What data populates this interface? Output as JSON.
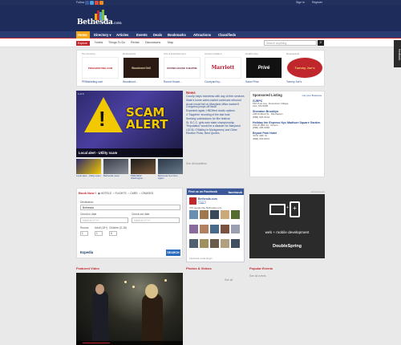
{
  "topbar": {
    "follow": "Follow",
    "sign_in": "Sign In",
    "register": "Register"
  },
  "logo": {
    "name": "Bethesda",
    "tld": ".com"
  },
  "nav": {
    "home": "Home",
    "items": [
      "Directory ▾",
      "Articles",
      "Events",
      "Deals",
      "Bookmarks",
      "Attractions",
      "Classifieds"
    ]
  },
  "subnav": {
    "explore": "Explore",
    "items": [
      "Hotels",
      "Things To Do",
      "Rental",
      "Discussions",
      "Map"
    ]
  },
  "search": {
    "placeholder": "Search anything"
  },
  "feedback": "feedback",
  "sponsors": [
    {
      "cat": "Pet Services",
      "logo": "PRMARKETING.COM",
      "name": "PRMarketing.com"
    },
    {
      "cat": "Restaurants",
      "logo": "Woodmont Grill",
      "name": "Woodmont..."
    },
    {
      "cat": "Arts & Entertainment",
      "logo": "ROUND HOUSE THEATRE",
      "name": "Round House..."
    },
    {
      "cat": "Accommodation",
      "logo": "Marriott",
      "name": "Courtyard by..."
    },
    {
      "cat": "Health Care",
      "logo": "Privé",
      "name": "Salon Prive"
    },
    {
      "cat": "Restaurants",
      "logo": "Tommy Joe's",
      "name": "Tommy Joe's"
    }
  ],
  "hero": {
    "tag": "1 of 6",
    "headline_line1": "SCAM",
    "headline_line2": "ALERT",
    "caption": "Local alert - Utility scam"
  },
  "thumbs": [
    {
      "label": "Local alert - Utility scam"
    },
    {
      "label": "Bethesda news"
    },
    {
      "label": "PREVIEW: Washington..."
    },
    {
      "label": "Bethesda Not Ours Again"
    }
  ],
  "news": {
    "title": "News",
    "items": [
      "County helps homeless with day of free services",
      "State's home sales market continues rebound",
      "Avoid crowd fail on Maryland office market if Congress jumps off fiscal",
      "Expected again, HBO/text studio options",
      "4 'Sapphire' shooting of the last host",
      "Seeking submissions for film festival",
      "St. B.C.C. girls earn state championship",
      "'Reputation' would be a disaster for Maryland",
      "LSCM, O'Malley in Montgomery and Other Election Picks, Best Quotes"
    ],
    "see_all": "See all headlines"
  },
  "listing": {
    "title": "Sponsored Listing",
    "list_your_business": "List your Business",
    "entries": [
      {
        "name": "GJRPC",
        "lines": [
          "915 Post Ave, Downtown Village",
          "212-726-5655"
        ]
      },
      {
        "name": "Sheraton Brooklyn",
        "lines": [
          "228 Duffield St., Manhattan",
          "(888) 625-5144"
        ]
      },
      {
        "name": "Holiday Inn Express Nyc Madison Square Garden",
        "lines": [
          "232 W 29th St., Clinton",
          "(888) 305-9082"
        ]
      },
      {
        "name": "Bryant Park Hotel",
        "lines": [
          "40 W 40th St.",
          "(888) 633-8972"
        ]
      }
    ]
  },
  "booking": {
    "title": "Book Now !",
    "tabs": [
      "HOTELS",
      "FLIGHTS",
      "CARS",
      "CRUISES"
    ],
    "destination_label": "Destination",
    "destination_value": "Bethesda",
    "checkin_label": "Check-in date",
    "checkout_label": "Check-out date",
    "checkin_placeholder": "MM/DD/YYYY",
    "checkout_placeholder": "MM/DD/YYYY",
    "rooms_label": "Rooms",
    "adult_label": "Adult (18+)",
    "children_label": "Children (0-18)",
    "rooms_value": "1",
    "adult_value": "1",
    "children_value": "0",
    "provider": "Expedia",
    "search_button": "SEARCH"
  },
  "facebook": {
    "header": "Find us on Facebook",
    "brand": "facebook",
    "page_name": "Bethesda.com",
    "like": "Like",
    "count": "370 people like Bethesda.com.",
    "plugin": "Facebook social plugin",
    "faces": [
      "#6b8fb0",
      "#a07850",
      "#3a4a5a",
      "#c9a87a",
      "#556b2f",
      "#8a6a9a",
      "#b08060",
      "#4a6a8a",
      "#7a5040",
      "#9aa0b0",
      "#506070",
      "#a09060",
      "#6a5a4a",
      "#b0a080",
      "#405060"
    ]
  },
  "ad": {
    "label": "advertisement",
    "line": "web + mobile development",
    "brand": "DoubleSpring"
  },
  "sections": {
    "featured_video": "Featured Video",
    "photos_videos": "Photos & Videos",
    "popular_events": "Popular Events",
    "see_all_events": "See all events",
    "see_all_short": "See all"
  },
  "colors": {
    "nav_bg": "#2a3b72",
    "accent": "#c0272d",
    "home_tab": "#f2a91c",
    "facebook": "#3b5998"
  }
}
